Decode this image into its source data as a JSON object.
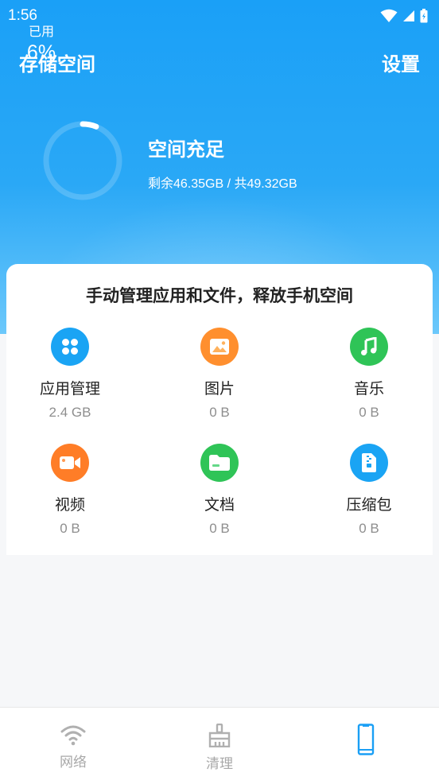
{
  "status_bar": {
    "time": "1:56"
  },
  "header": {
    "title": "存储空间",
    "settings_label": "设置"
  },
  "usage": {
    "label": "已用",
    "percent_text": "6%",
    "fraction": 0.06,
    "status": "空间充足",
    "detail": "剩余46.35GB / 共49.32GB"
  },
  "card": {
    "title": "手动管理应用和文件，释放手机空间",
    "items": [
      {
        "label": "应用管理",
        "size": "2.4 GB",
        "icon": "apps-icon",
        "color": "#1aa4f4"
      },
      {
        "label": "图片",
        "size": "0 B",
        "icon": "image-icon",
        "color": "#ff8f2e"
      },
      {
        "label": "音乐",
        "size": "0 B",
        "icon": "music-icon",
        "color": "#2fc457"
      },
      {
        "label": "视频",
        "size": "0 B",
        "icon": "video-icon",
        "color": "#ff7d27"
      },
      {
        "label": "文档",
        "size": "0 B",
        "icon": "folder-icon",
        "color": "#2fc457"
      },
      {
        "label": "压缩包",
        "size": "0 B",
        "icon": "zip-icon",
        "color": "#1aa4f4"
      }
    ]
  },
  "bottom_nav": {
    "items": [
      {
        "label": "网络",
        "icon": "wifi-icon"
      },
      {
        "label": "清理",
        "icon": "broom-icon"
      },
      {
        "label": "",
        "icon": "phone-icon",
        "active": true
      }
    ]
  },
  "colors": {
    "brand": "#1aa0f7",
    "active_nav": "#1a9ff5",
    "inactive_nav": "#a8a8a8"
  }
}
